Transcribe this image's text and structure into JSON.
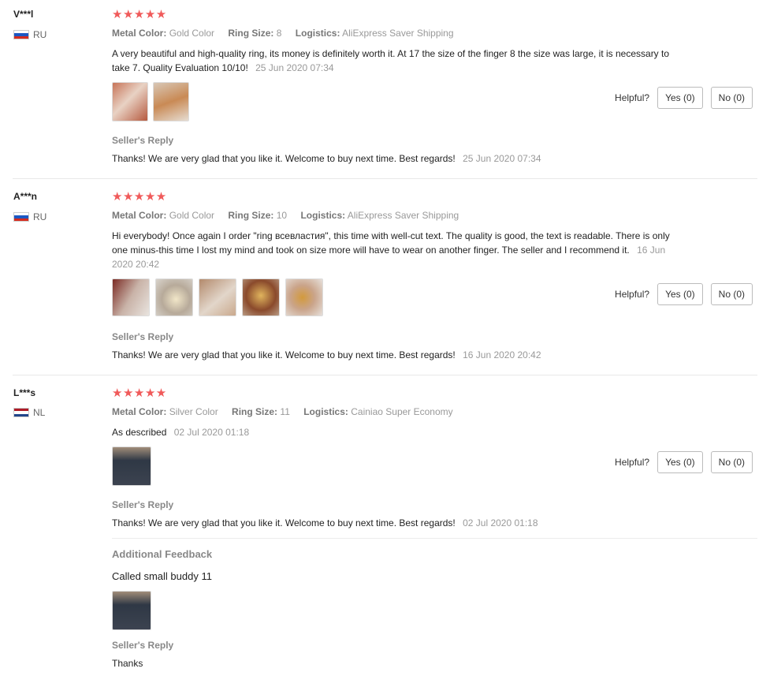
{
  "reviews": [
    {
      "user": "V***l",
      "country": "RU",
      "stars": "★★★★★",
      "rating": 5,
      "props": [
        {
          "k": "Metal Color:",
          "v": "Gold Color"
        },
        {
          "k": "Ring Size:",
          "v": "8"
        },
        {
          "k": "Logistics:",
          "v": "AliExpress Saver Shipping"
        }
      ],
      "text": "A very beautiful and high-quality ring, its money is definitely worth it. At 17 the size of the finger 8 the size was large, it is necessary to take 7. Quality Evaluation 10/10!",
      "date": "25 Jun 2020 07:34",
      "helpful_label": "Helpful?",
      "yes_label": "Yes (0)",
      "no_label": "No (0)",
      "seller_reply_title": "Seller's Reply",
      "seller_reply": "Thanks! We are very glad that you like it. Welcome to buy next time. Best regards!",
      "seller_reply_date": "25 Jun 2020 07:34"
    },
    {
      "user": "A***n",
      "country": "RU",
      "stars": "★★★★★",
      "rating": 5,
      "props": [
        {
          "k": "Metal Color:",
          "v": "Gold Color"
        },
        {
          "k": "Ring Size:",
          "v": "10"
        },
        {
          "k": "Logistics:",
          "v": "AliExpress Saver Shipping"
        }
      ],
      "text": "Hi everybody! Once again I order \"ring всевластия\", this time with well-cut text. The quality is good, the text is readable. There is only one minus-this time I lost my mind and took on size more will have to wear on another finger. The seller and I recommend it.",
      "date": "16 Jun 2020 20:42",
      "helpful_label": "Helpful?",
      "yes_label": "Yes (0)",
      "no_label": "No (0)",
      "seller_reply_title": "Seller's Reply",
      "seller_reply": "Thanks! We are very glad that you like it. Welcome to buy next time. Best regards!",
      "seller_reply_date": "16 Jun 2020 20:42"
    },
    {
      "user": "L***s",
      "country": "NL",
      "stars": "★★★★★",
      "rating": 5,
      "props": [
        {
          "k": "Metal Color:",
          "v": "Silver Color"
        },
        {
          "k": "Ring Size:",
          "v": "11"
        },
        {
          "k": "Logistics:",
          "v": "Cainiao Super Economy"
        }
      ],
      "text": "As described",
      "date": "02 Jul 2020 01:18",
      "helpful_label": "Helpful?",
      "yes_label": "Yes (0)",
      "no_label": "No (0)",
      "seller_reply_title": "Seller's Reply",
      "seller_reply": "Thanks! We are very glad that you like it. Welcome to buy next time. Best regards!",
      "seller_reply_date": "02 Jul 2020 01:18",
      "additional_title": "Additional Feedback",
      "additional_text": "Called small buddy 11",
      "additional_reply_title": "Seller's Reply",
      "additional_reply": "Thanks"
    }
  ],
  "colors": {
    "star": "#f05a5a",
    "ru_flag": [
      "#ffffff",
      "#1c57c2",
      "#d52b1e"
    ],
    "nl_flag": [
      "#ae1c28",
      "#ffffff",
      "#21468b"
    ]
  }
}
